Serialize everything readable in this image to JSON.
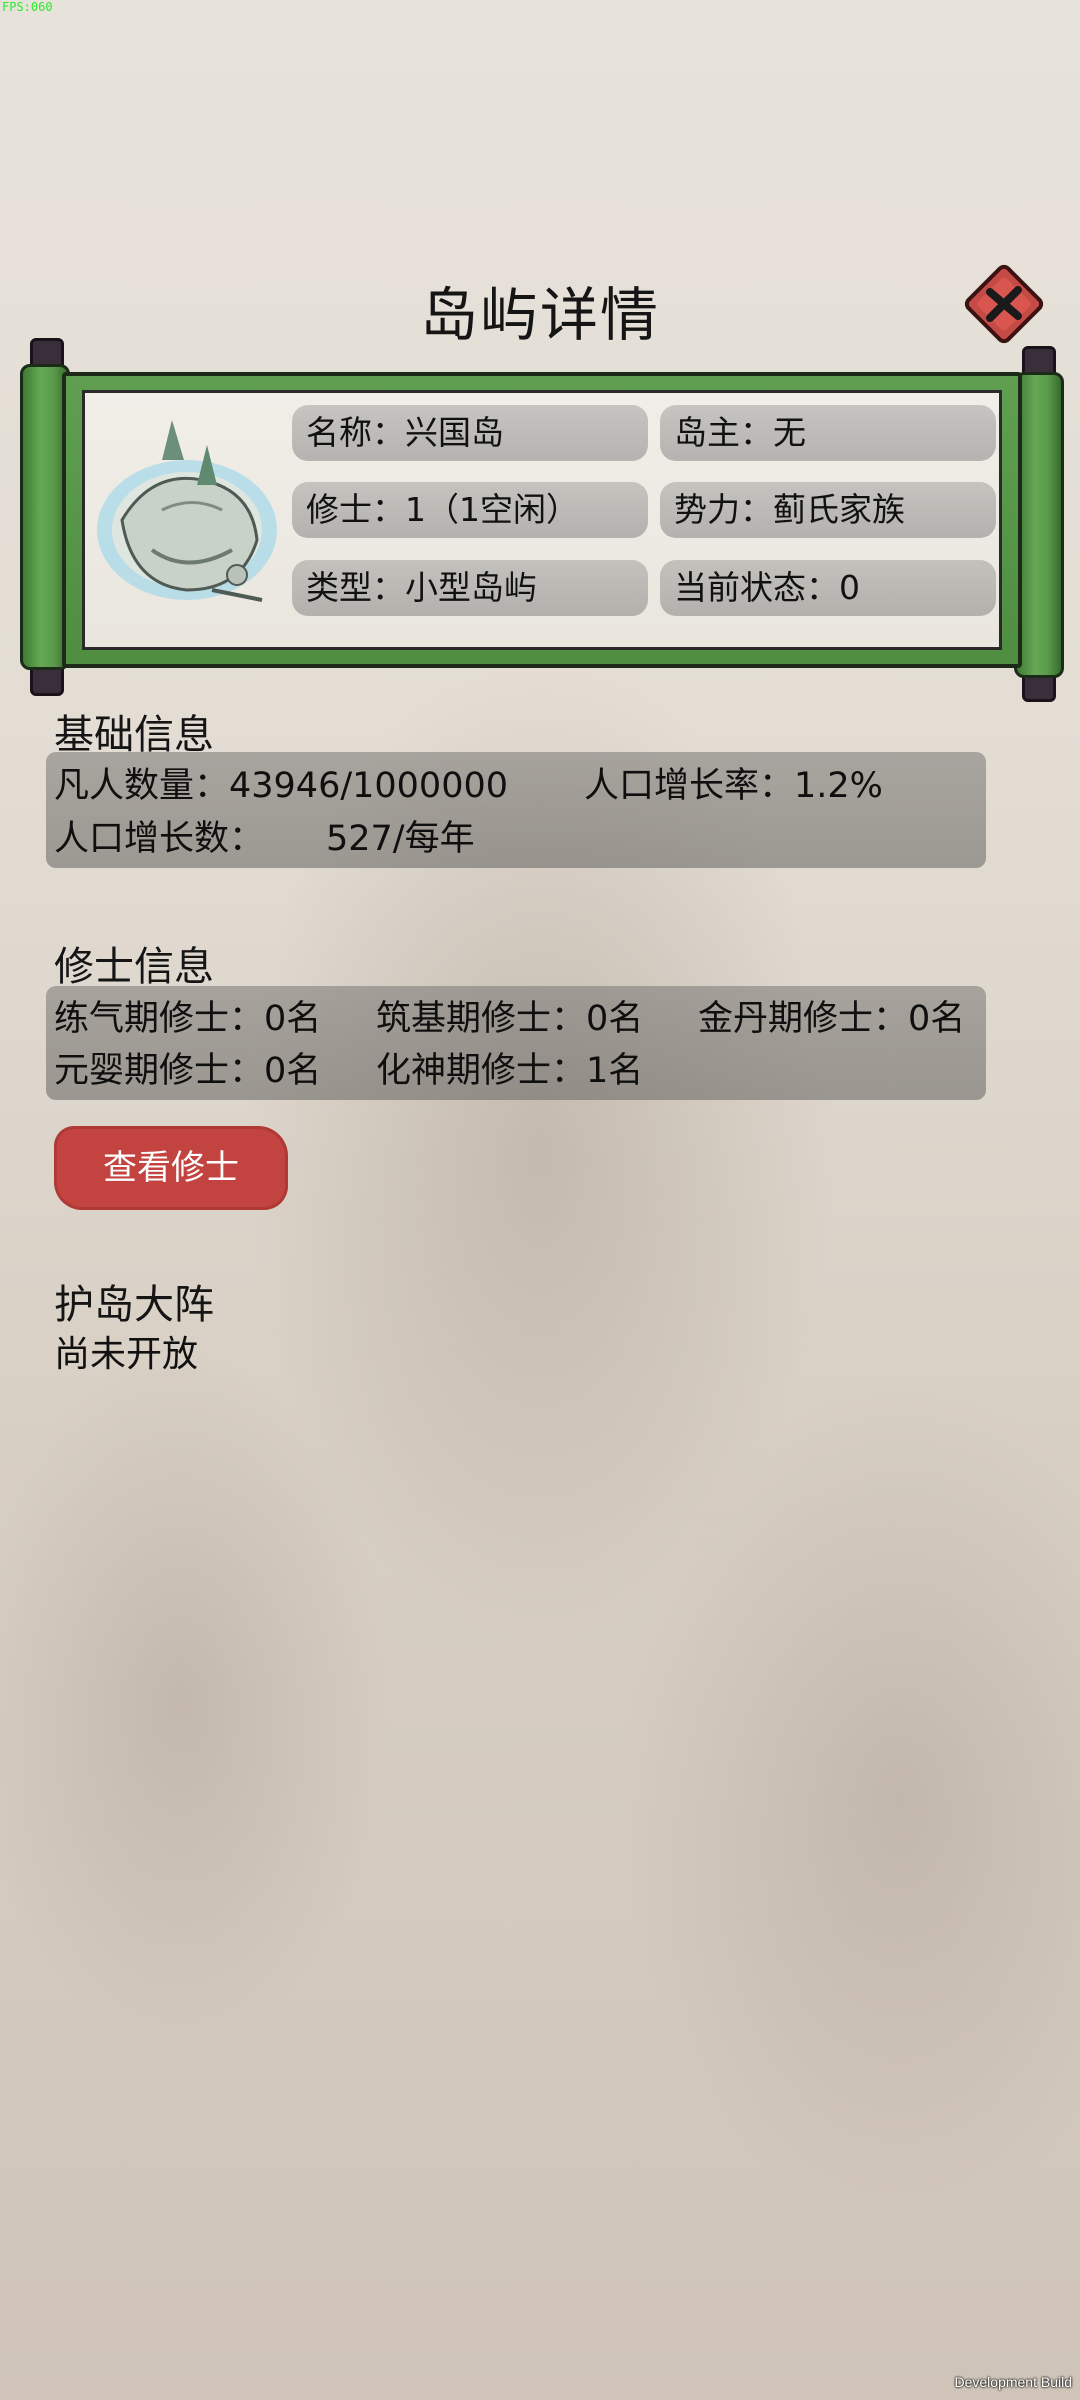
{
  "debug": {
    "fps": "FPS:060",
    "build_label": "Development Build"
  },
  "header": {
    "title": "岛屿详情",
    "close_icon": "close-x-icon"
  },
  "island_card": {
    "name": "名称：兴国岛",
    "owner": "岛主：无",
    "cultivators": "修士：1（1空闲）",
    "faction": "势力：蓟氏家族",
    "type": "类型：小型岛屿",
    "status": "当前状态：0",
    "image_icon": "floating-island-icon"
  },
  "basic_info": {
    "title": "基础信息",
    "population": "凡人数量：43946/1000000",
    "growth_rate": "人口增长率：1.2%",
    "growth_count_label": "人口增长数：",
    "growth_count_value": "527/每年"
  },
  "cultivator_info": {
    "title": "修士信息",
    "qi": "练气期修士：0名",
    "foundation": "筑基期修士：0名",
    "golden_core": "金丹期修士：0名",
    "nascent": "元婴期修士：0名",
    "spirit": "化神期修士：1名",
    "view_button": "查看修士"
  },
  "formation": {
    "title": "护岛大阵",
    "status": "尚未开放"
  },
  "colors": {
    "scroll_green": "#5a9a4b",
    "button_red": "#c2433f",
    "background": "#e3ddd4"
  }
}
